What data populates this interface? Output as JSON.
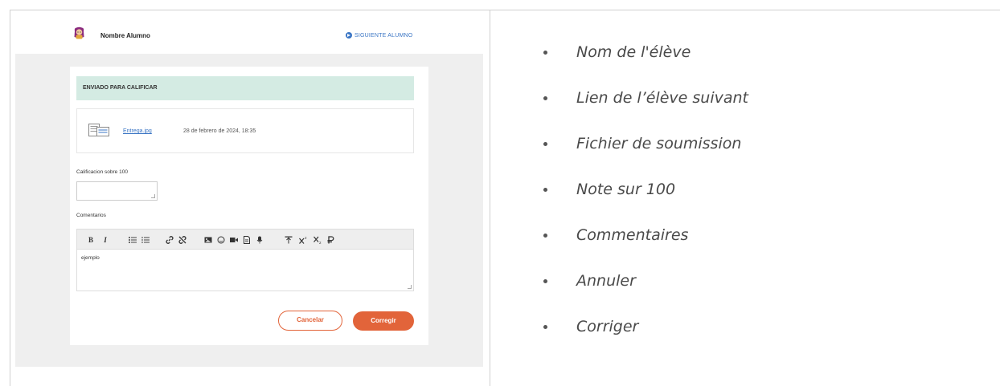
{
  "screenshot": {
    "student_name": "Nombre Alumno",
    "next_student_label": "SIGUIENTE ALUMNO",
    "banner_label": "ENVIADO PARA CALIFICAR",
    "file": {
      "name": "Entrega.jpg",
      "date": "28 de febrero de 2024, 18:35"
    },
    "grade_label": "Calificacion sobre 100",
    "grade_value": "",
    "comments_label": "Comentarios",
    "toolbar": {
      "bold": "B",
      "italic": "I"
    },
    "editor_text": "ejemplo",
    "cancel_label": "Cancelar",
    "correct_label": "Corregir",
    "colors": {
      "accent": "#e2643a",
      "link": "#3a75c4",
      "banner": "#d4ebe3",
      "avatar": "#8b2a7e"
    }
  },
  "legend": {
    "items": [
      "Nom de l'élève",
      "Lien de l’élève suivant",
      "Fichier de soumission",
      "Note sur 100",
      "Commentaires",
      "Annuler",
      "Corriger"
    ]
  }
}
